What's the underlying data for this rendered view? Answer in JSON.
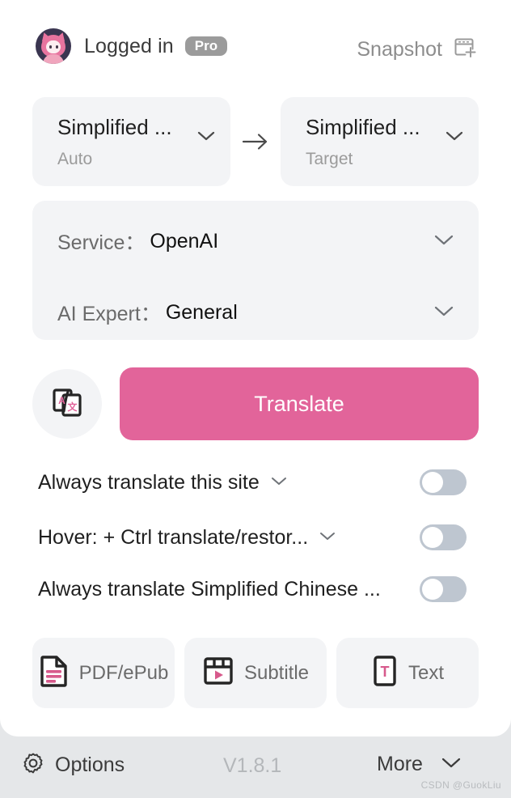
{
  "header": {
    "logged_in_label": "Logged in",
    "pro_badge": "Pro",
    "snapshot_label": "Snapshot",
    "snapshot_icon": "window-plus-icon",
    "avatar_icon": "user-avatar"
  },
  "languages": {
    "source": {
      "name": "Simplified ...",
      "sub": "Auto"
    },
    "arrow": "arrow-right-icon",
    "target": {
      "name": "Simplified ...",
      "sub": "Target"
    }
  },
  "service_card": {
    "rows": [
      {
        "label": "Service：",
        "value": "OpenAI"
      },
      {
        "label": "AI Expert：",
        "value": "General"
      }
    ]
  },
  "translate": {
    "swap_icon": "translate-language-icon",
    "button_label": "Translate"
  },
  "toggles": [
    {
      "label": "Always translate this site",
      "has_chevron": true,
      "state": "off"
    },
    {
      "label": "Hover:  + Ctrl translate/restor...",
      "has_chevron": true,
      "state": "off"
    },
    {
      "label": "Always translate Simplified Chinese ...",
      "has_chevron": false,
      "state": "off"
    }
  ],
  "tiles": [
    {
      "label": "PDF/ePub",
      "icon": "document-icon"
    },
    {
      "label": "Subtitle",
      "icon": "video-play-icon"
    },
    {
      "label": "Text",
      "icon": "text-box-icon"
    }
  ],
  "footer": {
    "options_label": "Options",
    "options_icon": "gear-icon",
    "version": "V1.8.1",
    "more_label": "More",
    "more_icon": "chevron-down-icon",
    "watermark": "CSDN @GuokLiu"
  },
  "colors": {
    "accent_pink": "#e2649a",
    "card_gray": "#f3f4f6",
    "footer_gray": "#e5e7e9",
    "toggle_off": "#bec6d0",
    "badge_gray": "#9b9b9b"
  }
}
